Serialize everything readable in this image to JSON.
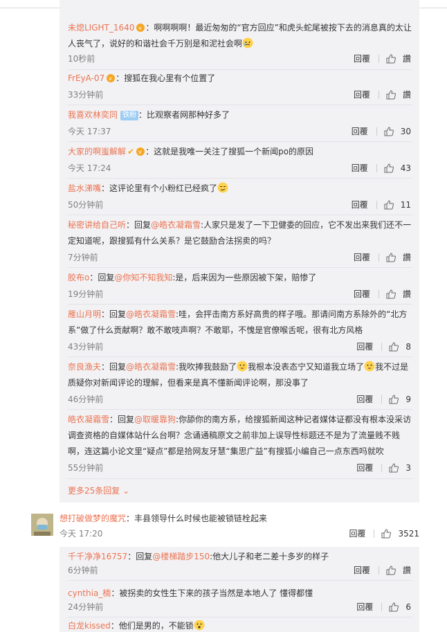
{
  "comments": [
    {
      "user": "未熄LIGHT_1640",
      "text": "：啊啊啊啊！最近匆匆的“官方回应”和虎头蛇尾被按下去的消息真的太让人丧气了，说好的和谐社会千万别是和泥社会啊",
      "time": "10秒前",
      "reply": "回覆",
      "likes": "讚"
    },
    {
      "user": "FrEyA-07",
      "text": "：搜狐在我心里有个位置了",
      "time": "33分钟前",
      "reply": "回覆",
      "likes": "讚"
    },
    {
      "user": "我喜欢林奕同",
      "fan": "铁粉",
      "text": "：比观察者网那种好多了",
      "time": "今天 17:37",
      "reply": "回覆",
      "likes": "30"
    },
    {
      "user": "大家的啊蚩解解",
      "text": "：这就是我唯一关注了搜狐一个新闻po的原因",
      "time": "今天 17:24",
      "reply": "回覆",
      "likes": "43"
    },
    {
      "user": "盐水涕嘴",
      "text": "：这评论里有个小粉红已经疯了",
      "time": "50分钟前",
      "reply": "回覆",
      "likes": "11"
    },
    {
      "user": "秘密讲给自己听",
      "reply_prefix": "：回复",
      "at": "@皓衣凝霜雪",
      "text": ":人家只是发了一下卫健委的回应，它不发出来我们还不一定知道呢，跟搜狐有什么关系？是它鼓励合法拐卖的吗？",
      "time": "7分钟前",
      "reply": "回覆",
      "likes": "讚"
    },
    {
      "user": "胶布o",
      "reply_prefix": "：回复",
      "at": "@你知不知我知",
      "text": ":是，后来因为一些原因被下架，赔惨了",
      "time": "19分钟前",
      "reply": "回覆",
      "likes": "讚"
    },
    {
      "user": "雁山月明",
      "reply_prefix": "：回复",
      "at": "@皓衣凝霜雪",
      "text": ":哇，会抨击南方系好高贵的样子哦。那请问南方系除外的“北方系”做了什么贡献啊？敢不敢吱声啊？不敢耶，不愧是官僚喉舌呢，很有北方风格",
      "time": "43分钟前",
      "reply": "回覆",
      "likes": "8"
    },
    {
      "user": "奈良渔夫",
      "reply_prefix": "：回复",
      "at": "@皓衣凝霜雪",
      "text1": ":我吹捧我鼓励了",
      "text2": "我根本没表态宁又知道我立场了",
      "text3": "我不过是质疑你对新闻评论的理解，但看来是真不懂新闻评论啊，那没事了",
      "time": "46分钟前",
      "reply": "回覆",
      "likes": "9"
    },
    {
      "user": "皓衣凝霜雪",
      "reply_prefix": "：回复",
      "at": "@取暖靠狗",
      "text": ":你舔你的南方系，给搜狐新闻这种记者媒体证都没有根本没采访调查资格的自媒体站什么台啊？念诵通稿原文之前非加上误导性标题还不是为了流量贱不贱啊，连这篇小论文里“疑点”都是拾网友牙慧“集思广益”有搜狐小编自己一点东西吗就吹",
      "time": "55分钟前",
      "reply": "回覆",
      "likes": "3"
    }
  ],
  "more_replies": "更多25条回复",
  "top_comment": {
    "user": "想打破做梦的魔咒",
    "text": "：丰县领导什么时候也能被锁链栓起来",
    "time": "今天 17:20",
    "reply": "回覆",
    "likes": "3521"
  },
  "sub_replies": [
    {
      "user": "千千净净16757",
      "reply_prefix": "：回复",
      "at": "@楼梯踏步150",
      "text": ":他大儿子和老二差十多岁的样子",
      "time": "6分钟前",
      "reply": "回覆",
      "likes": "讚"
    },
    {
      "user": "cynthia_楠",
      "text": "：被拐卖的女性生下来的孩子当然是本地人了 懂得都懂",
      "time": "24分钟前",
      "reply": "回覆",
      "likes": "6"
    },
    {
      "user": "白龙kissed",
      "text": "：他们是男的，不能锁",
      "time": "",
      "reply": "",
      "likes": ""
    }
  ],
  "colors": {
    "accent": "#eb7350",
    "panel": "#f2f2f5",
    "muted": "#808080"
  }
}
